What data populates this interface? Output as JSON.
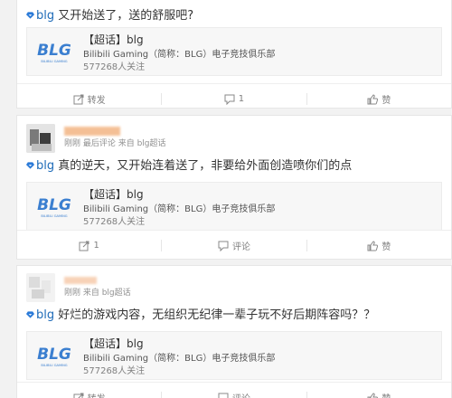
{
  "post1": {
    "tag": "blg",
    "text": " 又开始送了，送的舒服吧?",
    "embed": {
      "title": "【超话】blg",
      "subtitle": "Bilibili Gaming（简称：BLG）电子竞技俱乐部",
      "fans": "577268人关注",
      "logo_text": "BLG",
      "logo_sub": "BILIBILI GAMING"
    },
    "actions": {
      "repost": "转发",
      "comment": "1",
      "like": "赞"
    }
  },
  "post2": {
    "user": "",
    "meta": "刚刚 最后评论 来自 blg超话",
    "tag": "blg",
    "text": " 真的逆天，又开始连着送了，非要给外面创造喷你们的点",
    "embed": {
      "title": "【超话】blg",
      "subtitle": "Bilibili Gaming（简称：BLG）电子竞技俱乐部",
      "fans": "577268人关注",
      "logo_text": "BLG",
      "logo_sub": "BILIBILI GAMING"
    },
    "actions": {
      "repost": "1",
      "comment": "评论",
      "like": "赞"
    }
  },
  "post3": {
    "user": "",
    "meta": "刚刚 来自 blg超话",
    "tag": "blg",
    "text": " 好烂的游戏内容，无组织无纪律一辈子玩不好后期阵容吗？？",
    "embed": {
      "title": "【超话】blg",
      "subtitle": "Bilibili Gaming（简称：BLG）电子竞技俱乐部",
      "fans": "577268人关注",
      "logo_text": "BLG",
      "logo_sub": "BILIBILI GAMING"
    },
    "actions": {
      "repost": "转发",
      "comment": "评论",
      "like": "赞"
    }
  },
  "colors": {
    "tag": "#1e6bb8",
    "username": "#f08a3b",
    "logo": "#3b7fd0",
    "meta": "#909090"
  }
}
